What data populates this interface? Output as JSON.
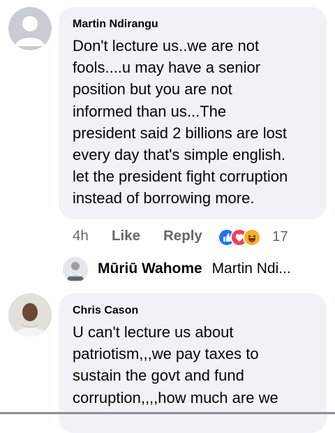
{
  "comment1": {
    "author": "Martin Ndirangu",
    "text_lines": [
      "Don't lecture us..we are not",
      "fools....u may have a senior",
      "position but you are not",
      "informed than us...The",
      "president said 2 billions are lost",
      "every day that's simple english.",
      "let the president fight corruption",
      "instead of borrowing more."
    ],
    "time": "4h",
    "like_label": "Like",
    "reply_label": "Reply",
    "reaction_count": "17",
    "reactions": [
      "like-reaction-icon",
      "love-reaction-icon",
      "haha-reaction-icon"
    ]
  },
  "reply1": {
    "author": "Mūriū Wahome",
    "preview": "Martin Ndi..."
  },
  "comment2": {
    "author": "Chris Cason",
    "text_lines": [
      "U can't lecture us about",
      "patriotism,,,we pay taxes to",
      "sustain the govt and fund",
      "corruption,,,,how much are we"
    ]
  },
  "colors": {
    "bubble": "#f0f2f5",
    "meta": "#65676b",
    "like_blue": "#1877f2",
    "love_red": "#f33e58",
    "haha_yellow": "#f7b125"
  }
}
